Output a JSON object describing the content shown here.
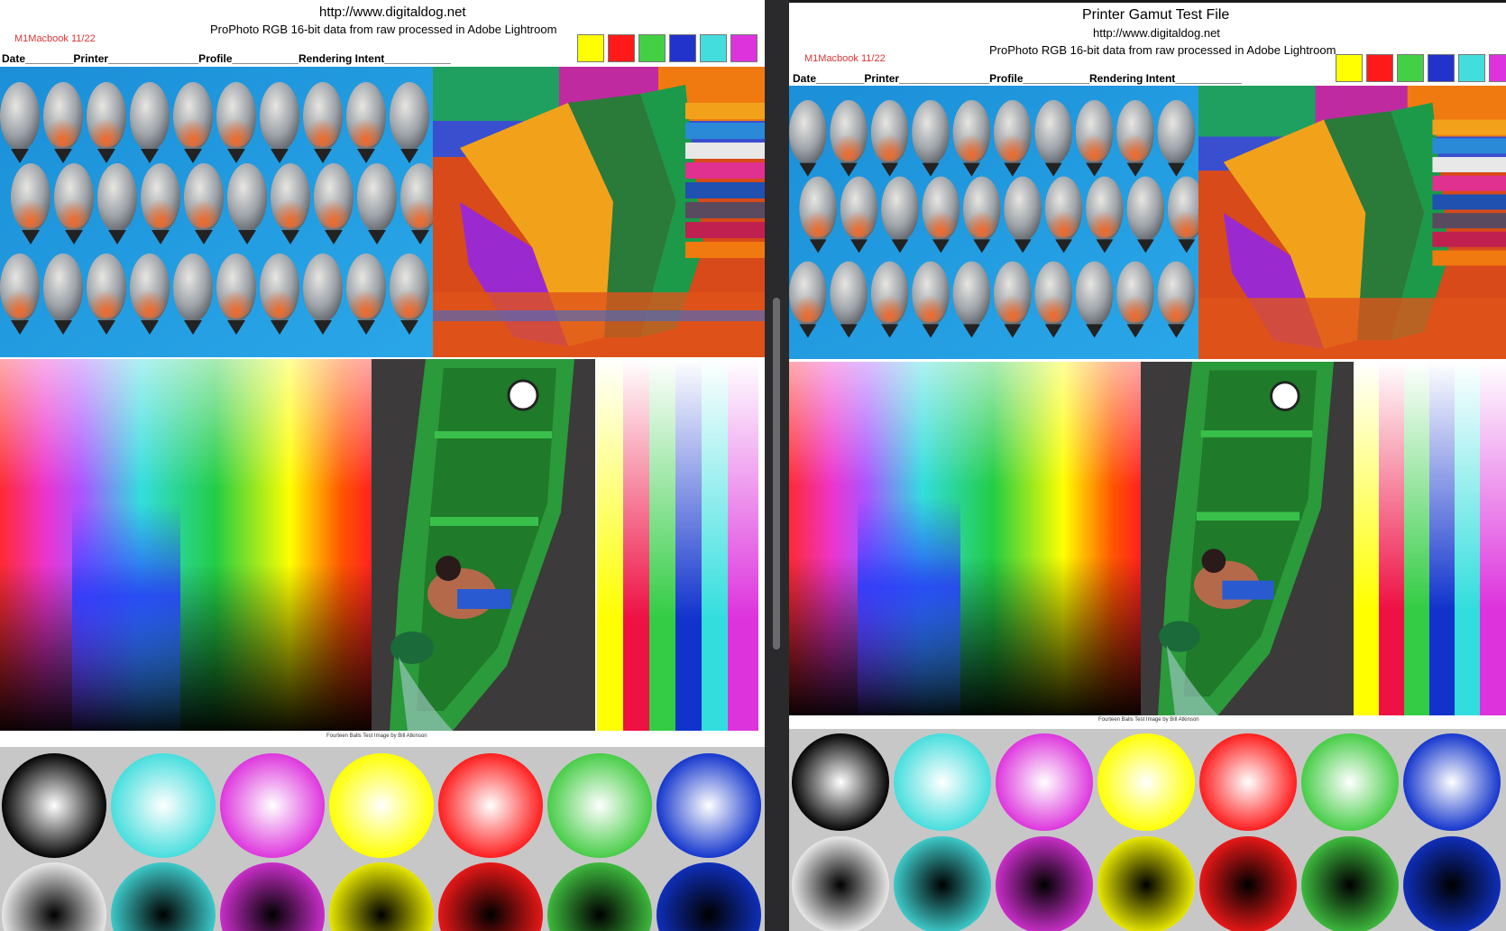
{
  "left": {
    "url": "http://www.digitaldog.net",
    "subtitle": "ProPhoto RGB 16-bit data from raw processed in Adobe Lightroom",
    "note": "M1Macbook 11/22",
    "fields": "Date________Printer_______________Profile___________Rendering Intent___________",
    "caption": "Fourteen Balls Test Image by Bill Atkinson"
  },
  "right": {
    "title": "Printer Gamut Test File",
    "url": "http://www.digitaldog.net",
    "subtitle": "ProPhoto RGB 16-bit data from raw processed in Adobe Lightroom",
    "note": "M1Macbook 11/22",
    "fields": "Date________Printer_______________Profile___________Rendering Intent___________",
    "caption": "Fourteen Balls Test Image by Bill Atkinson"
  },
  "colors": {
    "swatches": [
      "#ffff00",
      "#ff1a1a",
      "#44d044",
      "#2233cc",
      "#44dddd",
      "#dd33dd"
    ],
    "balls": [
      "#222222",
      "#44dddd",
      "#dd33dd",
      "#ffff00",
      "#ff1a1a",
      "#44cc44",
      "#1133cc"
    ],
    "stripes": [
      "#ffff00",
      "#ee1144",
      "#33cc44",
      "#1133cc",
      "#33dddd",
      "#dd33dd"
    ]
  }
}
